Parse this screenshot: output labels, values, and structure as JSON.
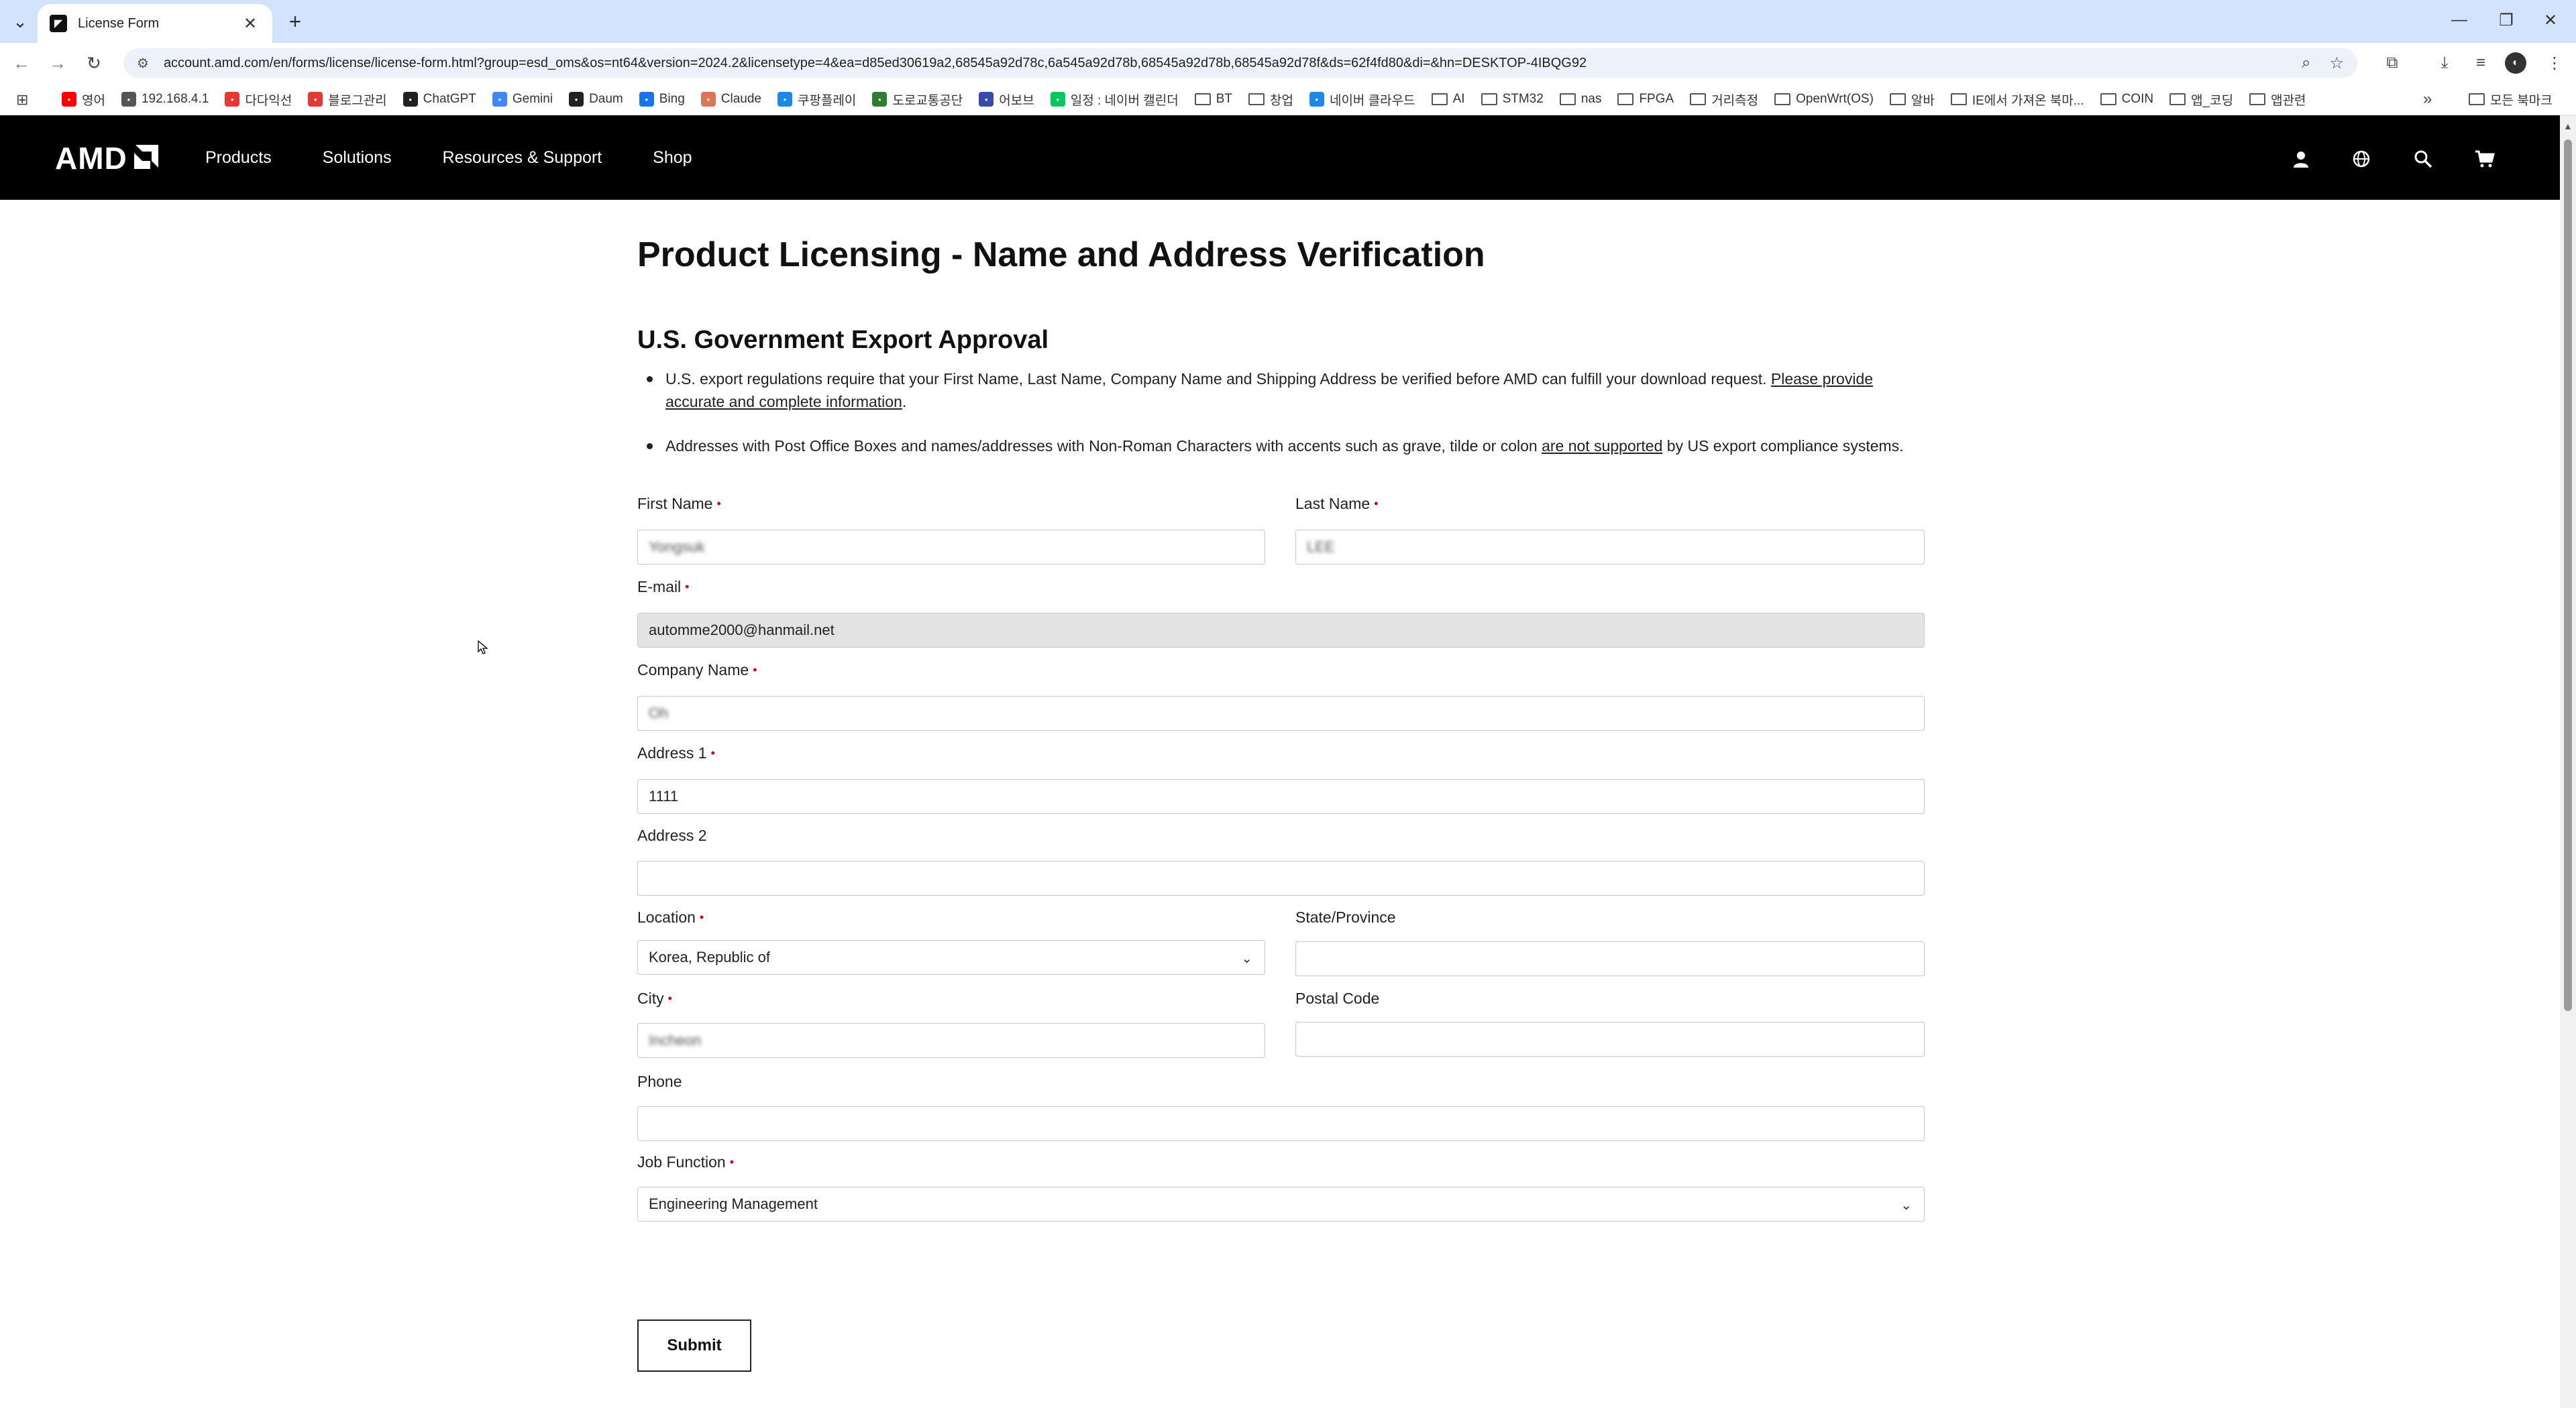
{
  "browser": {
    "tab_title": "License Form",
    "url": "account.amd.com/en/forms/license/license-form.html?group=esd_oms&os=nt64&version=2024.2&licensetype=4&ea=d85ed30619a2,68545a92d78c,6a545a92d78b,68545a92d78b,68545a92d78f&ds=62f4fd80&di=&hn=DESKTOP-4IBQG92",
    "bookmarks": [
      {
        "label": "영어",
        "icon": "youtube-icon",
        "color": "#ff0000"
      },
      {
        "label": "192.168.4.1",
        "icon": "globe-icon",
        "color": "#555555"
      },
      {
        "label": "다다익선",
        "icon": "red-circle-icon",
        "color": "#e53935"
      },
      {
        "label": "블로그관리",
        "icon": "red-circle-icon",
        "color": "#e53935"
      },
      {
        "label": "ChatGPT",
        "icon": "chatgpt-icon",
        "color": "#222222"
      },
      {
        "label": "Gemini",
        "icon": "gemini-icon",
        "color": "#4285f4"
      },
      {
        "label": "Daum",
        "icon": "daum-icon",
        "color": "#222222"
      },
      {
        "label": "Bing",
        "icon": "bing-icon",
        "color": "#1a73e8"
      },
      {
        "label": "Claude",
        "icon": "claude-icon",
        "color": "#d97757"
      },
      {
        "label": "쿠팡플레이",
        "icon": "play-icon",
        "color": "#1e88e5"
      },
      {
        "label": "도로교통공단",
        "icon": "road-icon",
        "color": "#2e7d32"
      },
      {
        "label": "어보브",
        "icon": "above-icon",
        "color": "#3949ab"
      },
      {
        "label": "일정 : 네이버 캘린더",
        "icon": "naver-icon",
        "color": "#03c75a"
      },
      {
        "label": "BT",
        "icon": "folder-icon",
        "color": "#555555"
      },
      {
        "label": "창업",
        "icon": "folder-icon",
        "color": "#555555"
      },
      {
        "label": "네이버 클라우드",
        "icon": "cloud-icon",
        "color": "#1e88e5"
      },
      {
        "label": "AI",
        "icon": "folder-icon",
        "color": "#555555"
      },
      {
        "label": "STM32",
        "icon": "folder-icon",
        "color": "#555555"
      },
      {
        "label": "nas",
        "icon": "folder-icon",
        "color": "#555555"
      },
      {
        "label": "FPGA",
        "icon": "folder-icon",
        "color": "#555555"
      },
      {
        "label": "거리측정",
        "icon": "folder-icon",
        "color": "#555555"
      },
      {
        "label": "OpenWrt(OS)",
        "icon": "folder-icon",
        "color": "#555555"
      },
      {
        "label": "알바",
        "icon": "folder-icon",
        "color": "#555555"
      },
      {
        "label": "IE에서 가져온 북마...",
        "icon": "folder-icon",
        "color": "#555555"
      },
      {
        "label": "COIN",
        "icon": "folder-icon",
        "color": "#555555"
      },
      {
        "label": "앱_코딩",
        "icon": "folder-icon",
        "color": "#555555"
      },
      {
        "label": "앱관련",
        "icon": "folder-icon",
        "color": "#555555"
      }
    ],
    "all_bookmarks": "모든 북마크"
  },
  "header": {
    "logo": "AMD",
    "nav": [
      "Products",
      "Solutions",
      "Resources & Support",
      "Shop"
    ]
  },
  "page": {
    "title": "Product Licensing - Name and Address Verification",
    "section_title": "U.S. Government Export Approval",
    "note1_pre": "U.S. export regulations require that your First Name, Last Name, Company Name and Shipping Address be verified before AMD can fulfill your download request.  ",
    "note1_link": "Please provide accurate and complete information",
    "note1_post": ".",
    "note2_pre": "Addresses with Post Office Boxes and names/addresses with Non-Roman Characters with accents such as grave, tilde or colon ",
    "note2_link": "are not supported",
    "note2_post": " by US export compliance systems."
  },
  "form": {
    "required_mark": "•",
    "first_name": {
      "label": "First Name",
      "value": "Yongsuk"
    },
    "last_name": {
      "label": "Last Name",
      "value": "LEE"
    },
    "email": {
      "label": "E-mail",
      "value": "automme2000@hanmail.net"
    },
    "company": {
      "label": "Company Name",
      "value": "Oh"
    },
    "address1": {
      "label": "Address 1",
      "value": "1111"
    },
    "address2": {
      "label": "Address 2",
      "value": ""
    },
    "location": {
      "label": "Location",
      "value": "Korea, Republic of"
    },
    "state": {
      "label": "State/Province",
      "value": ""
    },
    "city": {
      "label": "City",
      "value": "Incheon"
    },
    "postal": {
      "label": "Postal Code",
      "value": ""
    },
    "phone": {
      "label": "Phone",
      "value": ""
    },
    "job_function": {
      "label": "Job Function",
      "value": "Engineering Management"
    },
    "submit_label": "Submit"
  }
}
